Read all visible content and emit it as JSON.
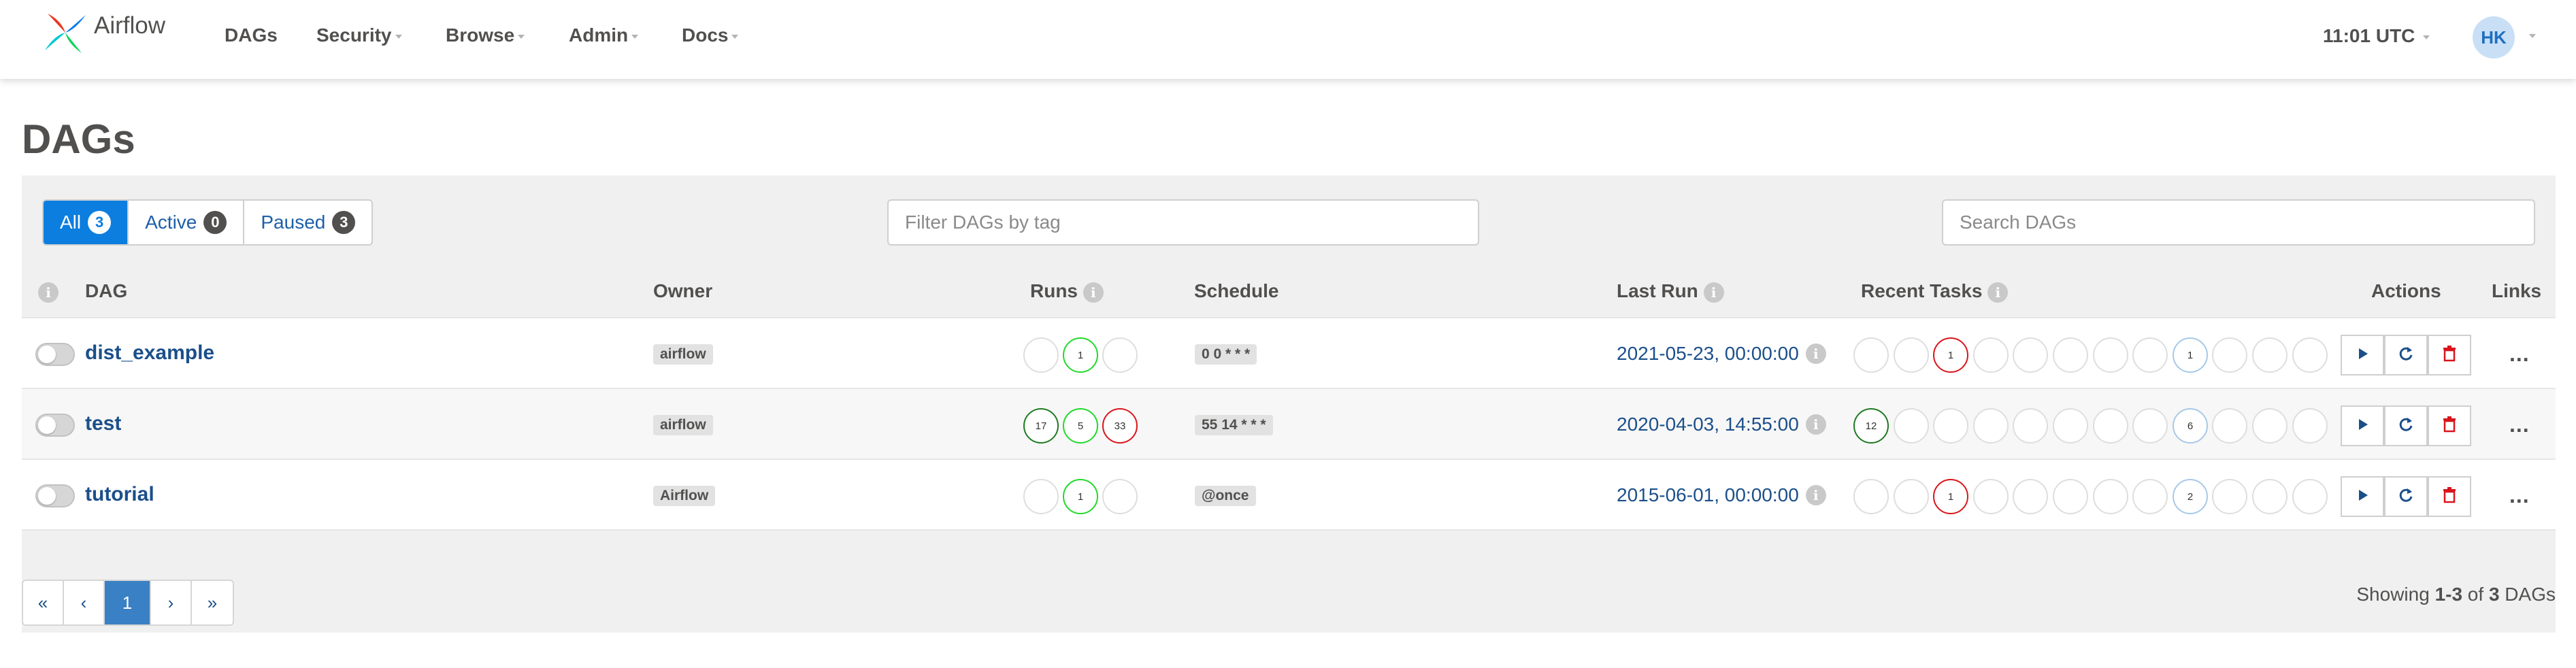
{
  "navbar": {
    "brand": "Airflow",
    "items": [
      {
        "label": "DAGs",
        "has_caret": false
      },
      {
        "label": "Security",
        "has_caret": true
      },
      {
        "label": "Browse",
        "has_caret": true
      },
      {
        "label": "Admin",
        "has_caret": true
      },
      {
        "label": "Docs",
        "has_caret": true
      }
    ],
    "time": "11:01 UTC",
    "user_initials": "HK"
  },
  "page_title": "DAGs",
  "filters": {
    "status": [
      {
        "label": "All",
        "count": "3",
        "active": true
      },
      {
        "label": "Active",
        "count": "0",
        "active": false
      },
      {
        "label": "Paused",
        "count": "3",
        "active": false
      }
    ],
    "tag_placeholder": "Filter DAGs by tag",
    "search_placeholder": "Search DAGs"
  },
  "columns": {
    "info": "i",
    "dag": "DAG",
    "owner": "Owner",
    "runs": "Runs",
    "schedule": "Schedule",
    "last_run": "Last Run",
    "recent_tasks": "Recent Tasks",
    "actions": "Actions",
    "links": "Links"
  },
  "dags": [
    {
      "name": "dist_example",
      "owner": "airflow",
      "paused": true,
      "runs": [
        {
          "count": "",
          "state": "none"
        },
        {
          "count": "1",
          "state": "success"
        },
        {
          "count": "",
          "state": "none"
        }
      ],
      "schedule": "0 0 * * *",
      "last_run": "2021-05-23, 00:00:00",
      "recent_tasks": [
        {
          "count": "",
          "state": "none"
        },
        {
          "count": "",
          "state": "none"
        },
        {
          "count": "1",
          "state": "failed"
        },
        {
          "count": "",
          "state": "none"
        },
        {
          "count": "",
          "state": "none"
        },
        {
          "count": "",
          "state": "none"
        },
        {
          "count": "",
          "state": "none"
        },
        {
          "count": "",
          "state": "none"
        },
        {
          "count": "1",
          "state": "scheduled"
        },
        {
          "count": "",
          "state": "none"
        },
        {
          "count": "",
          "state": "none"
        },
        {
          "count": "",
          "state": "none"
        }
      ]
    },
    {
      "name": "test",
      "owner": "airflow",
      "paused": true,
      "runs": [
        {
          "count": "17",
          "state": "running"
        },
        {
          "count": "5",
          "state": "success"
        },
        {
          "count": "33",
          "state": "failed"
        }
      ],
      "schedule": "55 14 * * *",
      "last_run": "2020-04-03, 14:55:00",
      "recent_tasks": [
        {
          "count": "12",
          "state": "running"
        },
        {
          "count": "",
          "state": "none"
        },
        {
          "count": "",
          "state": "none"
        },
        {
          "count": "",
          "state": "none"
        },
        {
          "count": "",
          "state": "none"
        },
        {
          "count": "",
          "state": "none"
        },
        {
          "count": "",
          "state": "none"
        },
        {
          "count": "",
          "state": "none"
        },
        {
          "count": "6",
          "state": "scheduled"
        },
        {
          "count": "",
          "state": "none"
        },
        {
          "count": "",
          "state": "none"
        },
        {
          "count": "",
          "state": "none"
        }
      ]
    },
    {
      "name": "tutorial",
      "owner": "Airflow",
      "paused": true,
      "runs": [
        {
          "count": "",
          "state": "none"
        },
        {
          "count": "1",
          "state": "success"
        },
        {
          "count": "",
          "state": "none"
        }
      ],
      "schedule": "@once",
      "last_run": "2015-06-01, 00:00:00",
      "recent_tasks": [
        {
          "count": "",
          "state": "none"
        },
        {
          "count": "",
          "state": "none"
        },
        {
          "count": "1",
          "state": "failed"
        },
        {
          "count": "",
          "state": "none"
        },
        {
          "count": "",
          "state": "none"
        },
        {
          "count": "",
          "state": "none"
        },
        {
          "count": "",
          "state": "none"
        },
        {
          "count": "",
          "state": "none"
        },
        {
          "count": "2",
          "state": "scheduled"
        },
        {
          "count": "",
          "state": "none"
        },
        {
          "count": "",
          "state": "none"
        },
        {
          "count": "",
          "state": "none"
        }
      ]
    }
  ],
  "action_icons": [
    "play-icon",
    "refresh-icon",
    "trash-icon"
  ],
  "links_label": "...",
  "pagination": {
    "first": "«",
    "prev": "‹",
    "current": "1",
    "next": "›",
    "last": "»"
  },
  "showing": {
    "prefix": "Showing ",
    "range": "1-3",
    "middle": " of ",
    "total": "3",
    "suffix": " DAGs"
  },
  "colors": {
    "state_none": "#dedede",
    "state_success": "#22d92b",
    "state_running": "#1f7a23",
    "state_failed": "#d9151c",
    "state_scheduled": "#a7c9e8",
    "accent": "#0b7ee0",
    "link": "#1b4f8a"
  }
}
